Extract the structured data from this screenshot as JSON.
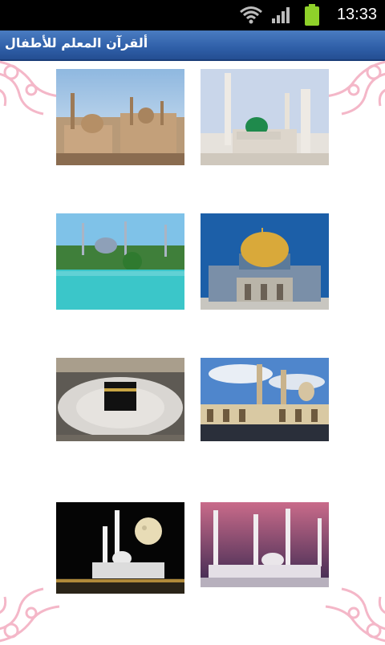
{
  "status_bar": {
    "time": "13:33"
  },
  "app": {
    "title": "ألقرآن المعلم للأطفال"
  },
  "gallery": {
    "items": [
      {
        "name": "cairo-citadel-mosques",
        "icon": "mosque-skyline-image"
      },
      {
        "name": "prophets-mosque-medina",
        "icon": "green-dome-mosque-image"
      },
      {
        "name": "blue-mosque-istanbul",
        "icon": "blue-mosque-image"
      },
      {
        "name": "dome-of-the-rock",
        "icon": "golden-dome-image"
      },
      {
        "name": "kaaba-mecca",
        "icon": "kaaba-image"
      },
      {
        "name": "al-azhar-mosque",
        "icon": "courtyard-mosque-image"
      },
      {
        "name": "mosque-at-night-moon",
        "icon": "night-moon-mosque-image"
      },
      {
        "name": "mosque-at-dusk",
        "icon": "dusk-mosque-image"
      }
    ]
  },
  "colors": {
    "title_bar": "#2f5fa8",
    "ornament": "#f4b7c8"
  }
}
